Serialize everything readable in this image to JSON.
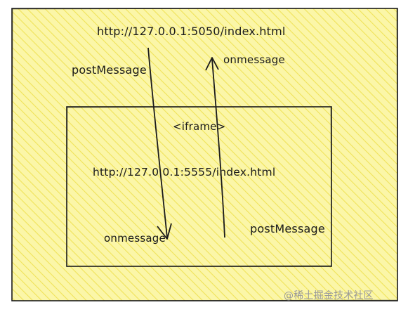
{
  "outer_window": {
    "url": "http://127.0.0.1:5050/index.html"
  },
  "iframe": {
    "tag": "<iframe>",
    "url": "http://127.0.0.1:5555/index.html"
  },
  "arrows": {
    "down_label": "postMessage",
    "down_target_label": "onmessage",
    "up_label": "postMessage",
    "up_target_label": "onmessage"
  },
  "watermark": "@稀土掘金技术社区",
  "colors": {
    "fill": "#fbf6a8",
    "hatch": "#f2e55e",
    "stroke": "#1a1a1a",
    "watermark": "#9a9a9a"
  }
}
